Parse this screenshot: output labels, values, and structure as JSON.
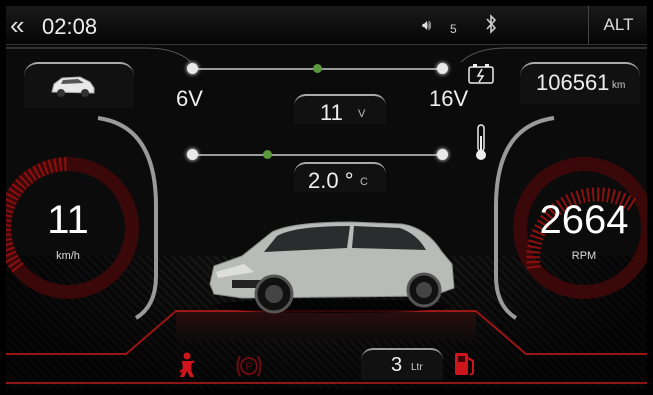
{
  "topbar": {
    "back_icon": "chevron-double-left-icon",
    "time": "02:08",
    "volume_icon": "speaker-icon",
    "volume_level": "5",
    "bluetooth_icon": "bluetooth-icon",
    "alt_label": "ALT"
  },
  "voltage": {
    "min_label": "6V",
    "max_label": "16V",
    "value": "11",
    "unit": "V",
    "level_fraction": 0.5,
    "icon": "battery-charge-icon"
  },
  "temperature": {
    "value": "2.0 °",
    "unit": "C",
    "level_fraction": 0.3,
    "icon": "thermometer-icon"
  },
  "odometer": {
    "value": "106561",
    "unit": "km"
  },
  "speed": {
    "value": "11",
    "unit": "km/h"
  },
  "rpm": {
    "value": "2664",
    "unit": "RPM"
  },
  "fuel": {
    "value": "3",
    "unit": "Ltr",
    "icon": "fuel-pump-icon"
  },
  "warnings": {
    "seatbelt_icon": "seatbelt-warning-icon",
    "brake_icon": "brake-warning-icon"
  },
  "colors": {
    "accent_red": "#c0161c",
    "slider_green": "#5a9a3a"
  }
}
